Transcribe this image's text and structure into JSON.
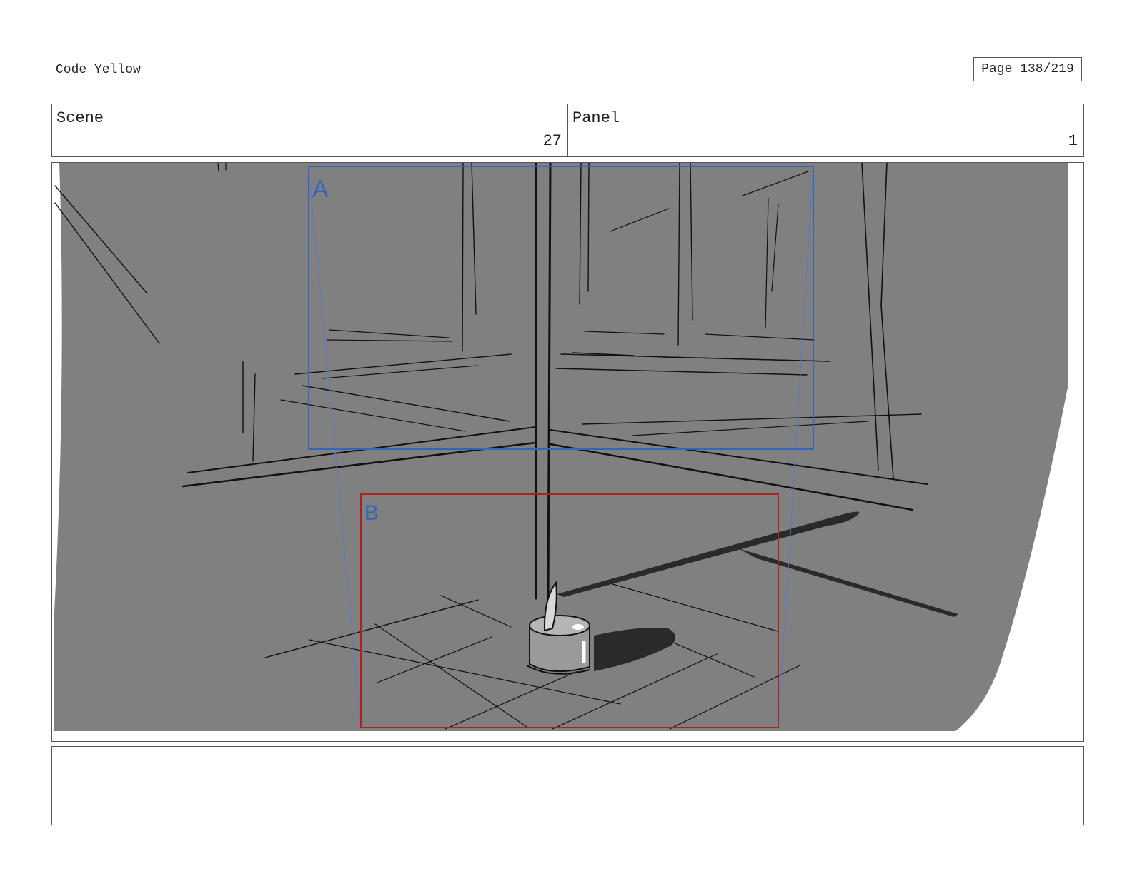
{
  "header": {
    "title": "Code Yellow",
    "page": "Page 138/219"
  },
  "info": {
    "scene_label": "Scene",
    "scene_value": "27",
    "panel_label": "Panel",
    "panel_value": "1"
  },
  "frame": {
    "camera_a_label": "A",
    "camera_b_label": "B",
    "colors": {
      "background": "#808080",
      "camera_a": "#3366bb",
      "camera_b": "#aa2222",
      "ink": "#111111",
      "shadow": "#2a2a2a"
    }
  },
  "notes": {
    "text": ""
  }
}
